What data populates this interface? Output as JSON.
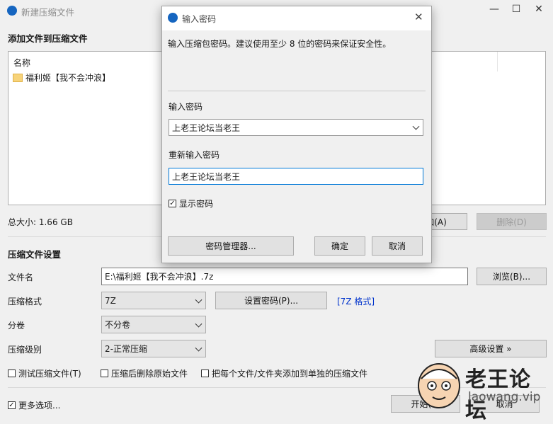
{
  "window": {
    "title": "新建压缩文件"
  },
  "add_files": {
    "heading": "添加文件到压缩文件",
    "column_name": "名称",
    "items": [
      "福利姬【我不会冲浪】"
    ],
    "total_size": "总大小: 1.66 GB",
    "add_button": "添加(A)",
    "delete_button": "删除(D)"
  },
  "settings": {
    "heading": "压缩文件设置",
    "filename_label": "文件名",
    "filename_value": "E:\\福利姬【我不会冲浪】.7z",
    "browse_button": "浏览(B)...",
    "format_label": "压缩格式",
    "format_value": "7Z",
    "set_password_button": "设置密码(P)...",
    "format_link": "[7Z 格式]",
    "volume_label": "分卷",
    "volume_value": "不分卷",
    "level_label": "压缩级别",
    "level_value": "2-正常压缩",
    "advanced_button": "高级设置 »",
    "test_label": "测试压缩文件(T)",
    "delete_after_label": "压缩后删除原始文件",
    "separate_label": "把每个文件/文件夹添加到单独的压缩文件",
    "more_options_label": "更多选项...",
    "start_button": "开始(S)",
    "cancel_button": "取消"
  },
  "dialog": {
    "title": "输入密码",
    "description": "输入压缩包密码。建议使用至少 8 位的密码来保证安全性。",
    "password_label": "输入密码",
    "password_value": "上老王论坛当老王",
    "reenter_label": "重新输入密码",
    "reenter_value": "上老王论坛当老王",
    "show_password_label": "显示密码",
    "show_password_checked": true,
    "manager_button": "密码管理器...",
    "ok_button": "确定",
    "cancel_button": "取消"
  },
  "watermark": {
    "title": "老王论坛",
    "url": "laowang.vip"
  }
}
